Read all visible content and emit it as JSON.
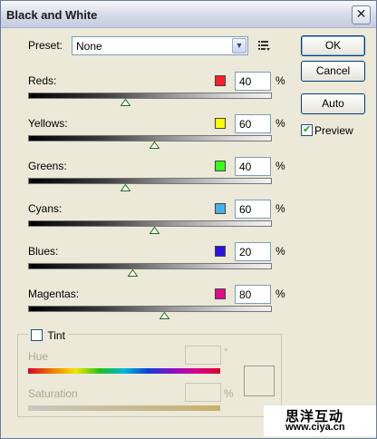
{
  "window": {
    "title": "Black and White",
    "close_glyph": "✕"
  },
  "preset": {
    "label": "Preset:",
    "value": "None",
    "menu_icon": "list-options-icon"
  },
  "buttons": {
    "ok": "OK",
    "cancel": "Cancel",
    "auto": "Auto"
  },
  "preview": {
    "label": "Preview",
    "checked": true
  },
  "sliders": [
    {
      "label": "Reds:",
      "value": "40",
      "unit": "%",
      "color": "#ff1e2b",
      "level": 0.4
    },
    {
      "label": "Yellows:",
      "value": "60",
      "unit": "%",
      "color": "#ffff00",
      "level": 0.52
    },
    {
      "label": "Greens:",
      "value": "40",
      "unit": "%",
      "color": "#39ff1a",
      "level": 0.4
    },
    {
      "label": "Cyans:",
      "value": "60",
      "unit": "%",
      "color": "#4ab0ec",
      "level": 0.52
    },
    {
      "label": "Blues:",
      "value": "20",
      "unit": "%",
      "color": "#2a12e6",
      "level": 0.43
    },
    {
      "label": "Magentas:",
      "value": "80",
      "unit": "%",
      "color": "#e30e8a",
      "level": 0.56
    }
  ],
  "tint": {
    "label": "Tint",
    "checked": false,
    "hue_label": "Hue",
    "hue_unit": "°",
    "saturation_label": "Saturation",
    "saturation_unit": "%"
  },
  "watermark": {
    "text_cn": "思洋互动",
    "url": "www.ciya.cn"
  }
}
